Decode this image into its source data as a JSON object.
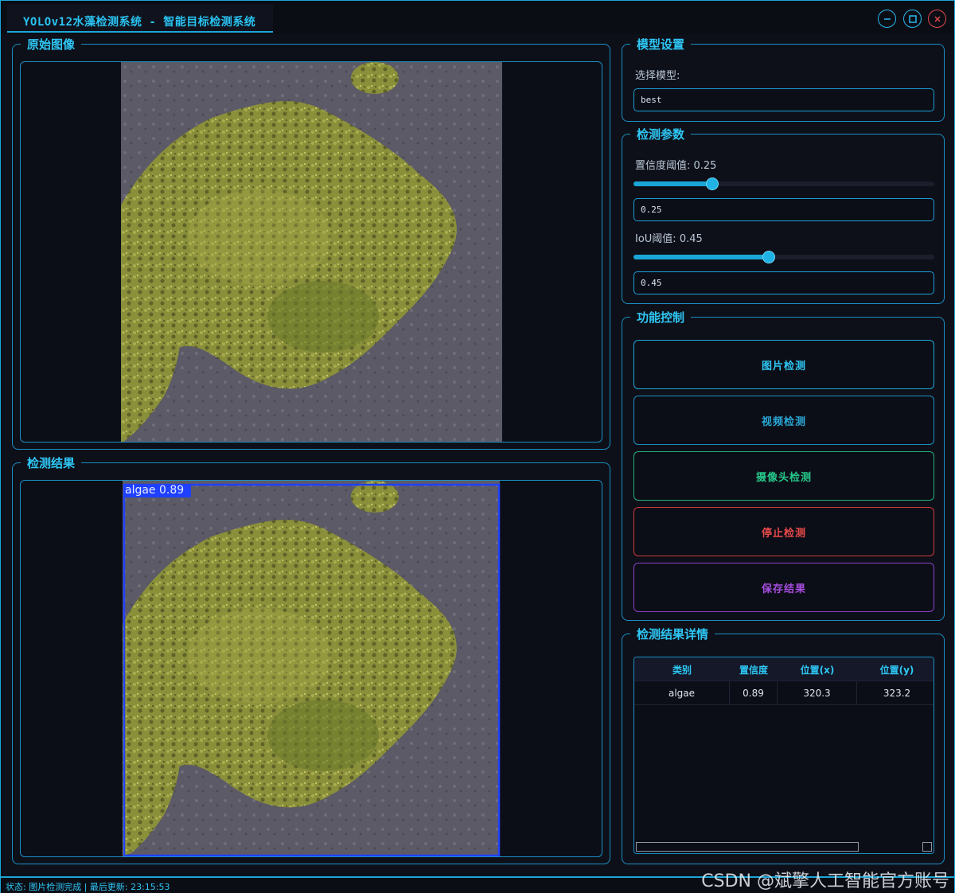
{
  "window": {
    "title": "YOLOv12水藻检测系统 - 智能目标检测系统"
  },
  "original_panel": {
    "title": "原始图像"
  },
  "result_panel": {
    "title": "检测结果",
    "detection_label": "algae 0.89"
  },
  "model_settings": {
    "title": "模型设置",
    "select_label": "选择模型:",
    "selected_model": "best"
  },
  "params": {
    "title": "检测参数",
    "confidence_label": "置信度阈值: 0.25",
    "confidence_value": "0.25",
    "confidence_level": 0.25,
    "iou_label": "IoU阈值: 0.45",
    "iou_value": "0.45",
    "iou_level": 0.45
  },
  "controls": {
    "title": "功能控制",
    "buttons": [
      {
        "label": "图片检测",
        "color": "#2ec7f5"
      },
      {
        "label": "视频检测",
        "color": "#2aa8d6"
      },
      {
        "label": "摄像头检测",
        "color": "#25c98a"
      },
      {
        "label": "停止检测",
        "color": "#e84a4a"
      },
      {
        "label": "保存结果",
        "color": "#a64de0"
      }
    ]
  },
  "details": {
    "title": "检测结果详情",
    "columns": [
      "类别",
      "置信度",
      "位置(x)",
      "位置(y)"
    ],
    "rows": [
      [
        "algae",
        "0.89",
        "320.3",
        "323.2"
      ]
    ]
  },
  "status_bar": {
    "text": "状态: 图片检测完成 | 最后更新: 23:15:53"
  },
  "watermark": "CSDN @斌擎人工智能官方账号",
  "colors": {
    "accent": "#1aa7d8",
    "title_text": "#2ec7f5",
    "background": "#0e1019",
    "detection_box": "#2040ff"
  },
  "icons": [
    "minimize-icon",
    "maximize-icon",
    "close-icon"
  ]
}
